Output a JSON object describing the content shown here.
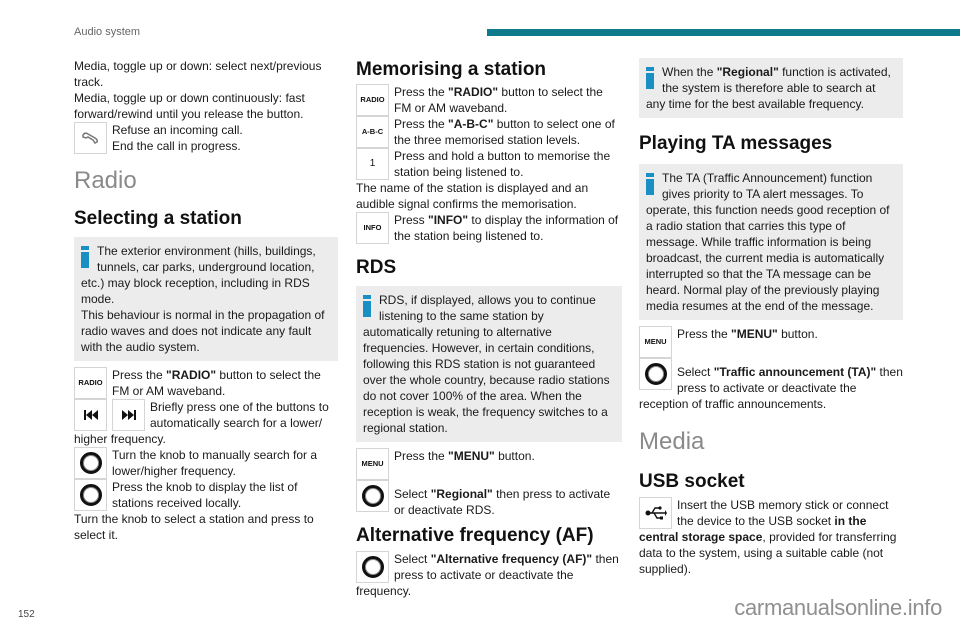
{
  "header": {
    "title": "Audio system",
    "accent_color": "#0e7b8c"
  },
  "footer": {
    "page_number": "152",
    "watermark": "carmanualsonline.info"
  },
  "col1": {
    "intro_lines": [
      "Media, toggle up or down: select next/previous track.",
      "Media, toggle up or down continuously: fast forward/rewind until you release the button."
    ],
    "phone_row": {
      "icon": "phone-hangup-icon",
      "lines": [
        "Refuse an incoming call.",
        "End the call in progress."
      ]
    },
    "section_title": "Radio",
    "subsection_title": "Selecting a station",
    "info_box": {
      "p1": "The exterior environment (hills, buildings, tunnels, car parks, underground location, etc.) may block reception, including in RDS mode.",
      "p2": "This behaviour is normal in the propagation of radio waves and does not indicate any fault with the audio system."
    },
    "radio_row": {
      "icon_label": "RADIO",
      "pre": "Press the ",
      "bold": "\"RADIO\"",
      "post": " button to select the FM or AM waveband."
    },
    "seek_row": {
      "icons": [
        "previous-track-icon",
        "next-track-icon"
      ],
      "text": "Briefly press one of the buttons to automatically search for a lower/ higher frequency."
    },
    "knob_turn_row": {
      "text": "Turn the knob to manually search for a lower/higher frequency."
    },
    "knob_press_row": {
      "text": "Press the knob to display the list of stations received locally."
    },
    "closing": "Turn the knob to select a station and press to select it."
  },
  "col2": {
    "title_memorise": "Memorising a station",
    "radio_row": {
      "icon_label": "RADIO",
      "pre": "Press the ",
      "bold": "\"RADIO\"",
      "post": " button to select the FM or AM waveband."
    },
    "abc_row": {
      "icon_label": "A-B-C",
      "pre": "Press the ",
      "bold": "\"A-B-C\"",
      "post": " button to select one of the three memorised station levels."
    },
    "one_row": {
      "icon_label": "1",
      "text": "Press and hold a button to memorise the station being listened to."
    },
    "memorise_note": "The name of the station is displayed and an audible signal confirms the memorisation.",
    "info_row": {
      "icon_label": "INFO",
      "pre": "Press ",
      "bold": "\"INFO\"",
      "post": " to display the information of the station being listened to."
    },
    "title_rds": "RDS",
    "rds_info": "RDS, if displayed, allows you to continue listening to the same station by automatically retuning to alternative frequencies. However, in certain conditions, following this RDS station is not guaranteed over the whole country, because radio stations do not cover 100% of the area. When the reception is weak, the frequency switches to a regional station.",
    "menu_row": {
      "icon_label": "MENU",
      "pre": "Press the ",
      "bold": "\"MENU\"",
      "post": " button."
    },
    "regional_row": {
      "pre": "Select ",
      "bold": "\"Regional\"",
      "post": " then press to activate or deactivate RDS."
    },
    "title_af": "Alternative frequency (AF)",
    "af_row": {
      "pre": "Select ",
      "bold": "\"Alternative frequency (AF)\"",
      "post": " then press to activate or deactivate the frequency."
    }
  },
  "col3": {
    "regional_info": {
      "pre": "When the ",
      "bold": "\"Regional\"",
      "post": " function is activated, the system is therefore able to search at any time for the best available frequency."
    },
    "title_ta": "Playing TA messages",
    "ta_info": "The TA (Traffic Announcement) function gives priority to TA alert messages. To operate, this function needs good reception of a radio station that carries this type of message. While traffic information is being broadcast, the current media is automatically interrupted so that the TA message can be heard. Normal play of the previously playing media resumes at the end of the message.",
    "menu_row": {
      "icon_label": "MENU",
      "pre": "Press the ",
      "bold": "\"MENU\"",
      "post": " button."
    },
    "ta_row": {
      "pre": "Select ",
      "bold": "\"Traffic announcement (TA)\"",
      "post": " then press to activate or deactivate the reception of traffic announcements."
    },
    "section_media": "Media",
    "title_usb": "USB socket",
    "usb_row": {
      "pre": "Insert the USB memory stick or connect the device to the USB socket ",
      "bold": "in the central storage space",
      "post": ", provided for transferring data to the system, using a suitable cable (not supplied)."
    }
  }
}
